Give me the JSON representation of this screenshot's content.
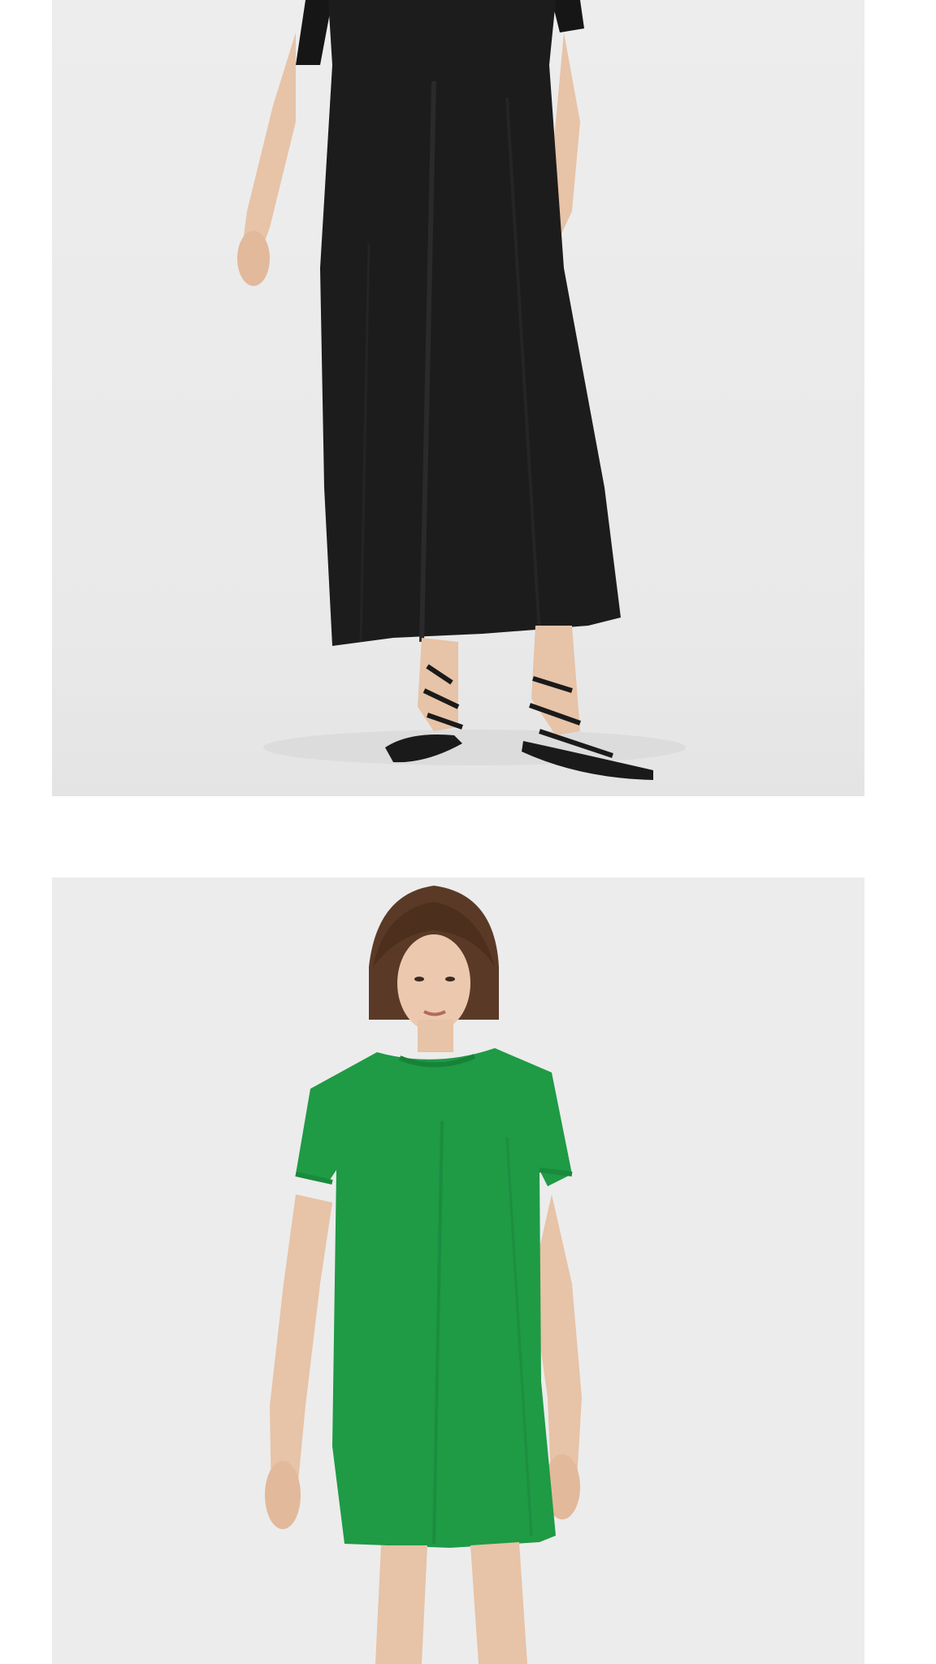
{
  "products": [
    {
      "image": "product-photo-black-midi-tshirt-dress",
      "dress_color": "#1c1c1c"
    },
    {
      "image": "product-photo-green-tshirt-mini-dress",
      "dress_color": "#1f9a45"
    }
  ],
  "colors": {
    "page_background": "#ffffff",
    "photo_background": "#ececec",
    "skin": "#e7c3a7",
    "hair": "#5a3a26",
    "sandal": "#1a1a1a"
  }
}
